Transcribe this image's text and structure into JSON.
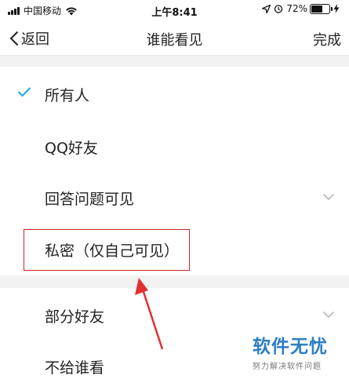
{
  "status_bar": {
    "carrier": "中国移动",
    "time": "上午8:41",
    "battery_percent": "72%",
    "battery_level": 0.72
  },
  "nav": {
    "back_label": "返回",
    "title": "谁能看见",
    "done_label": "完成"
  },
  "options": [
    {
      "label": "所有人",
      "selected": true,
      "expandable": false
    },
    {
      "label": "QQ好友",
      "selected": false,
      "expandable": false
    },
    {
      "label": "回答问题可见",
      "selected": false,
      "expandable": true
    },
    {
      "label": "私密（仅自己可见）",
      "selected": false,
      "expandable": false
    },
    {
      "label": "部分好友",
      "selected": false,
      "expandable": true
    },
    {
      "label": "不给谁看",
      "selected": false,
      "expandable": false
    }
  ],
  "watermark": {
    "main": "软件无忧",
    "sub": "努力解决软件问题"
  },
  "colors": {
    "check": "#2aa7e8",
    "annotation": "#d32222",
    "watermark": "#2d7ec2"
  }
}
